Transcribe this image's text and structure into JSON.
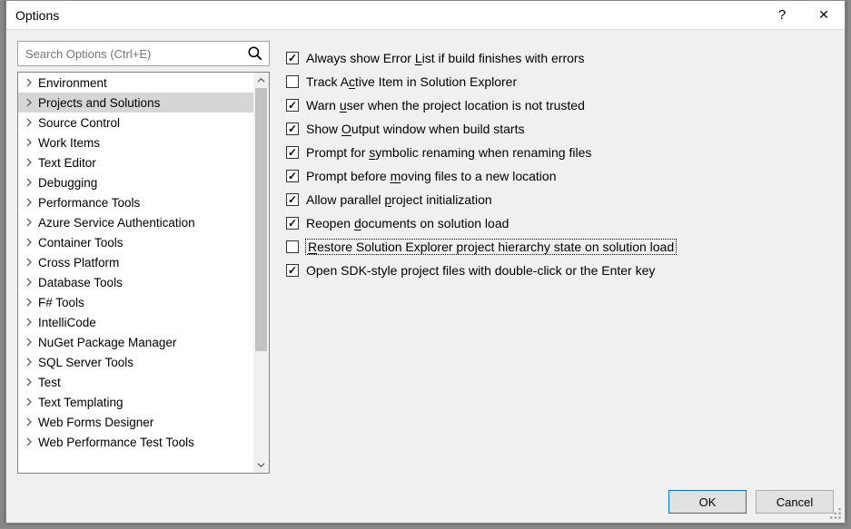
{
  "window": {
    "title": "Options",
    "help_tooltip": "?"
  },
  "search": {
    "placeholder": "Search Options (Ctrl+E)"
  },
  "tree": {
    "items": [
      {
        "label": "Environment",
        "selected": false
      },
      {
        "label": "Projects and Solutions",
        "selected": true
      },
      {
        "label": "Source Control",
        "selected": false
      },
      {
        "label": "Work Items",
        "selected": false
      },
      {
        "label": "Text Editor",
        "selected": false
      },
      {
        "label": "Debugging",
        "selected": false
      },
      {
        "label": "Performance Tools",
        "selected": false
      },
      {
        "label": "Azure Service Authentication",
        "selected": false
      },
      {
        "label": "Container Tools",
        "selected": false
      },
      {
        "label": "Cross Platform",
        "selected": false
      },
      {
        "label": "Database Tools",
        "selected": false
      },
      {
        "label": "F# Tools",
        "selected": false
      },
      {
        "label": "IntelliCode",
        "selected": false
      },
      {
        "label": "NuGet Package Manager",
        "selected": false
      },
      {
        "label": "SQL Server Tools",
        "selected": false
      },
      {
        "label": "Test",
        "selected": false
      },
      {
        "label": "Text Templating",
        "selected": false
      },
      {
        "label": "Web Forms Designer",
        "selected": false
      },
      {
        "label": "Web Performance Test Tools",
        "selected": false
      }
    ]
  },
  "checks": [
    {
      "checked": true,
      "focused": false,
      "pre": "Always show Error ",
      "u": "L",
      "post": "ist if build finishes with errors"
    },
    {
      "checked": false,
      "focused": false,
      "pre": "Track A",
      "u": "c",
      "post": "tive Item in Solution Explorer"
    },
    {
      "checked": true,
      "focused": false,
      "pre": "Warn ",
      "u": "u",
      "post": "ser when the project location is not trusted"
    },
    {
      "checked": true,
      "focused": false,
      "pre": "Show ",
      "u": "O",
      "post": "utput window when build starts"
    },
    {
      "checked": true,
      "focused": false,
      "pre": "Prompt for ",
      "u": "s",
      "post": "ymbolic renaming when renaming files"
    },
    {
      "checked": true,
      "focused": false,
      "pre": "Prompt before ",
      "u": "m",
      "post": "oving files to a new location"
    },
    {
      "checked": true,
      "focused": false,
      "pre": "Allow parallel ",
      "u": "p",
      "post": "roject initialization"
    },
    {
      "checked": true,
      "focused": false,
      "pre": "Reopen ",
      "u": "d",
      "post": "ocuments on solution load"
    },
    {
      "checked": false,
      "focused": true,
      "pre": "",
      "u": "R",
      "post": "estore Solution Explorer project hierarchy state on solution load"
    },
    {
      "checked": true,
      "focused": false,
      "pre": "Open SDK-style project files with double-click or the Enter key",
      "u": "",
      "post": ""
    }
  ],
  "buttons": {
    "ok": "OK",
    "cancel": "Cancel"
  }
}
